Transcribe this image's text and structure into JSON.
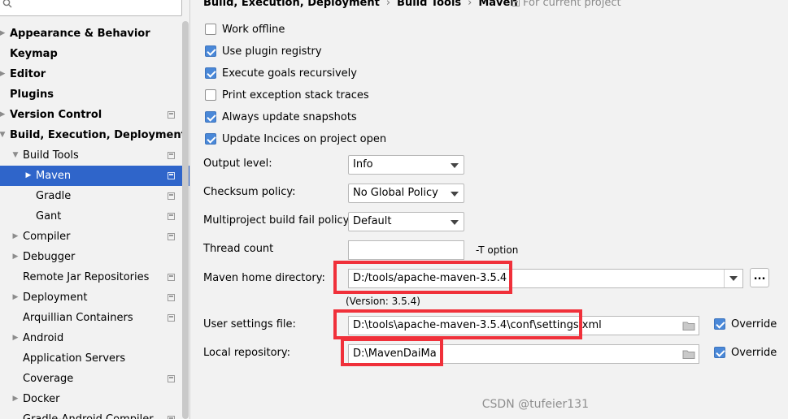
{
  "sidebar": {
    "search": {
      "placeholder": ""
    },
    "items": [
      {
        "label": "Appearance & Behavior",
        "bold": true,
        "arrow": "right",
        "indent": 0,
        "project_icon": false
      },
      {
        "label": "Keymap",
        "bold": true,
        "arrow": "",
        "indent": 0,
        "project_icon": false
      },
      {
        "label": "Editor",
        "bold": true,
        "arrow": "right",
        "indent": 0,
        "project_icon": false
      },
      {
        "label": "Plugins",
        "bold": true,
        "arrow": "",
        "indent": 0,
        "project_icon": false
      },
      {
        "label": "Version Control",
        "bold": true,
        "arrow": "right",
        "indent": 0,
        "project_icon": true
      },
      {
        "label": "Build, Execution, Deployment",
        "bold": true,
        "arrow": "down",
        "indent": 0,
        "project_icon": false
      },
      {
        "label": "Build Tools",
        "bold": false,
        "arrow": "down",
        "indent": 1,
        "project_icon": true
      },
      {
        "label": "Maven",
        "bold": false,
        "arrow": "right",
        "indent": 2,
        "project_icon": true,
        "selected": true
      },
      {
        "label": "Gradle",
        "bold": false,
        "arrow": "",
        "indent": 2,
        "project_icon": true
      },
      {
        "label": "Gant",
        "bold": false,
        "arrow": "",
        "indent": 2,
        "project_icon": true
      },
      {
        "label": "Compiler",
        "bold": false,
        "arrow": "right",
        "indent": 1,
        "project_icon": true
      },
      {
        "label": "Debugger",
        "bold": false,
        "arrow": "right",
        "indent": 1,
        "project_icon": false
      },
      {
        "label": "Remote Jar Repositories",
        "bold": false,
        "arrow": "",
        "indent": 1,
        "project_icon": true
      },
      {
        "label": "Deployment",
        "bold": false,
        "arrow": "right",
        "indent": 1,
        "project_icon": true
      },
      {
        "label": "Arquillian Containers",
        "bold": false,
        "arrow": "",
        "indent": 1,
        "project_icon": true
      },
      {
        "label": "Android",
        "bold": false,
        "arrow": "right",
        "indent": 1,
        "project_icon": false
      },
      {
        "label": "Application Servers",
        "bold": false,
        "arrow": "",
        "indent": 1,
        "project_icon": false
      },
      {
        "label": "Coverage",
        "bold": false,
        "arrow": "",
        "indent": 1,
        "project_icon": true
      },
      {
        "label": "Docker",
        "bold": false,
        "arrow": "right",
        "indent": 1,
        "project_icon": false
      },
      {
        "label": "Gradle-Android Compiler",
        "bold": false,
        "arrow": "",
        "indent": 1,
        "project_icon": true
      }
    ]
  },
  "breadcrumb": {
    "parts": [
      "Build, Execution, Deployment",
      "Build Tools",
      "Maven"
    ],
    "separator": "›",
    "scope": "For current project"
  },
  "checkboxes": [
    {
      "label": "Work offline",
      "checked": false
    },
    {
      "label": "Use plugin registry",
      "checked": true
    },
    {
      "label": "Execute goals recursively",
      "checked": true
    },
    {
      "label": "Print exception stack traces",
      "checked": false
    },
    {
      "label": "Always update snapshots",
      "checked": true
    },
    {
      "label": "Update Incices on project open",
      "checked": true
    }
  ],
  "fields": {
    "output_level": {
      "label": "Output level:",
      "value": "Info"
    },
    "checksum_policy": {
      "label": "Checksum policy:",
      "value": "No Global Policy"
    },
    "multiproject_fail": {
      "label": "Multiproject build fail policy:",
      "value": "Default"
    },
    "thread_count": {
      "label": "Thread count",
      "value": "",
      "suffix": "-T option"
    },
    "maven_home": {
      "label": "Maven home directory:",
      "value": "D:/tools/apache-maven-3.5.4",
      "browse": "...",
      "version": "(Version: 3.5.4)"
    },
    "user_settings": {
      "label": "User settings file:",
      "value": "D:\\tools\\apache-maven-3.5.4\\conf\\settings.xml",
      "override_label": "Override",
      "override": true
    },
    "local_repo": {
      "label": "Local repository:",
      "value": "D:\\MavenDaiMa",
      "override_label": "Override",
      "override": true
    }
  },
  "watermark": "CSDN @tufeier131",
  "colors": {
    "selection": "#2f65ca",
    "checkbox": "#4a88d8",
    "highlight": "#f0303a"
  }
}
